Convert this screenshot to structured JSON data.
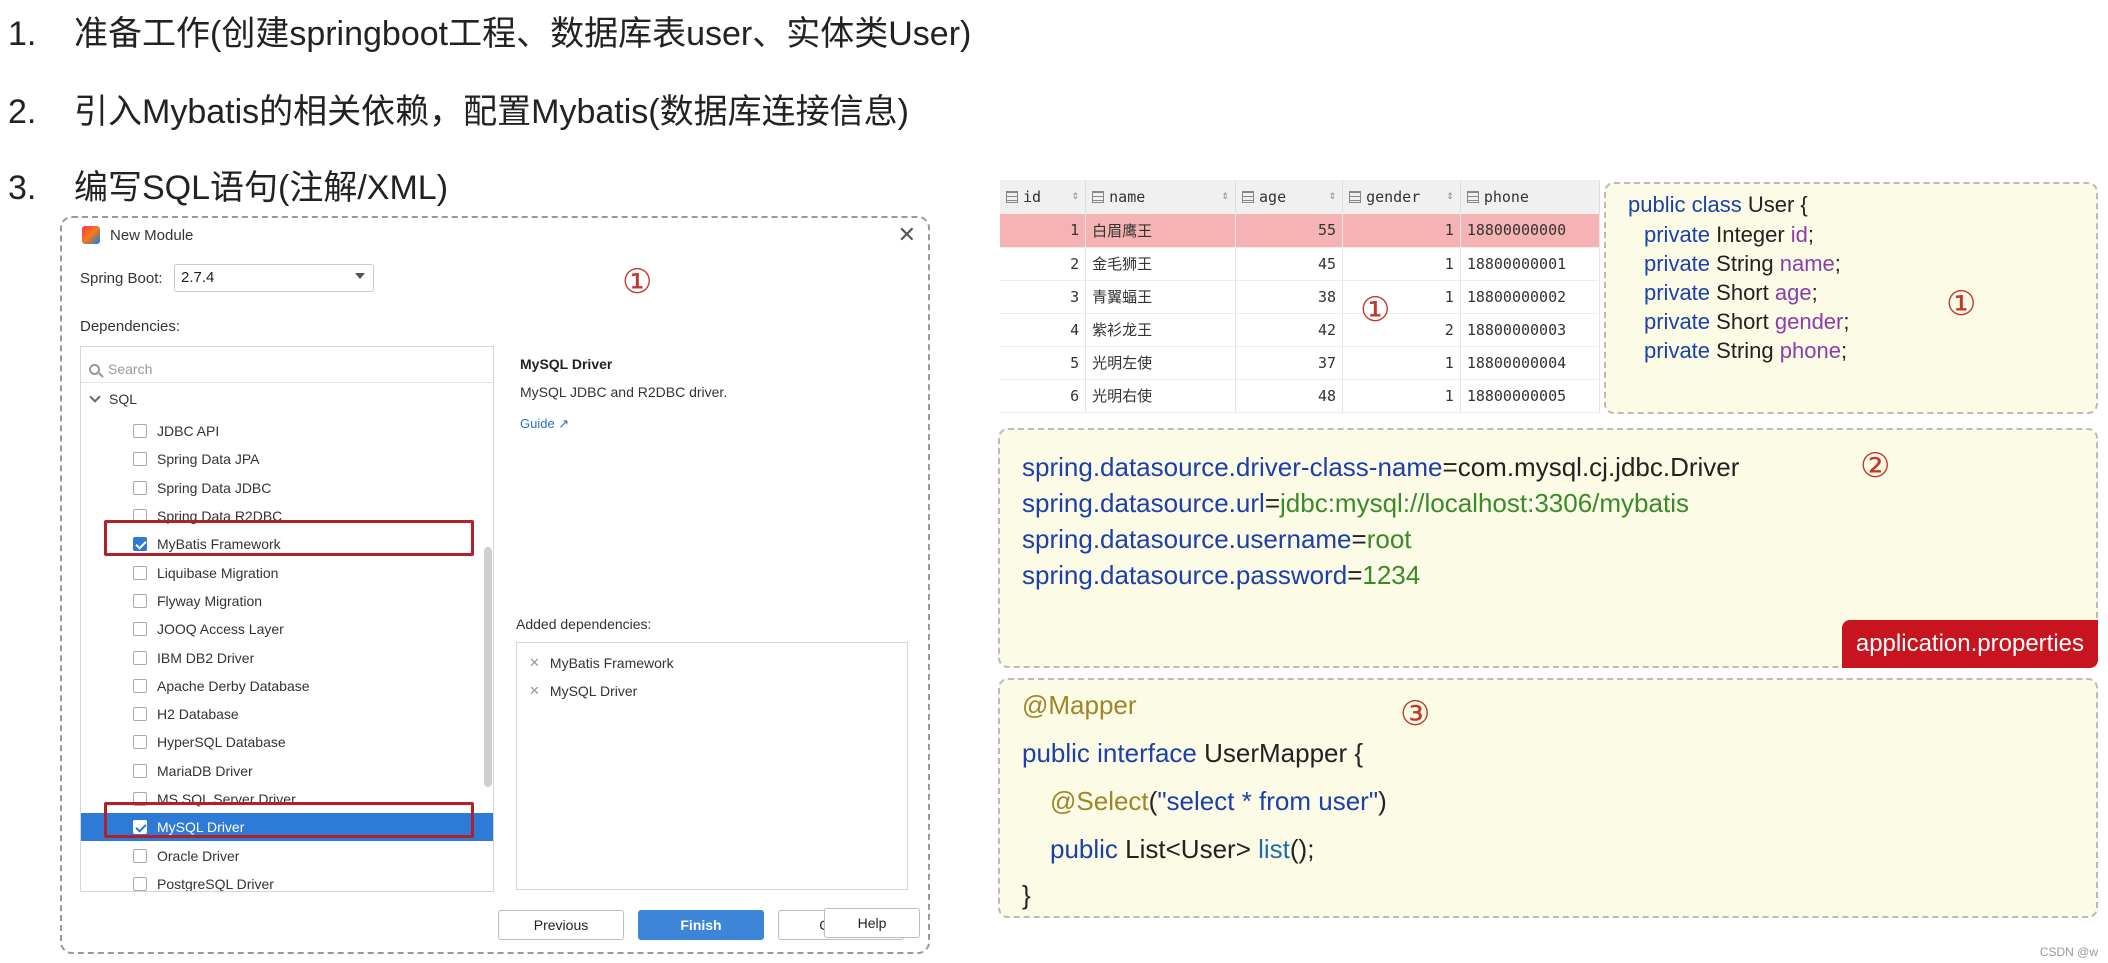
{
  "steps": [
    {
      "num": "1.",
      "text": "准备工作(创建springboot工程、数据库表user、实体类User)"
    },
    {
      "num": "2.",
      "text": "引入Mybatis的相关依赖，配置Mybatis(数据库连接信息)"
    },
    {
      "num": "3.",
      "text": "编写SQL语句(注解/XML)"
    }
  ],
  "dialog": {
    "title": "New Module",
    "spring_boot_label": "Spring Boot:",
    "spring_boot_value": "2.7.4",
    "dependencies_label": "Dependencies:",
    "search_placeholder": "Search",
    "group_name": "SQL",
    "items": [
      {
        "label": "JDBC API",
        "checked": false
      },
      {
        "label": "Spring Data JPA",
        "checked": false
      },
      {
        "label": "Spring Data JDBC",
        "checked": false
      },
      {
        "label": "Spring Data R2DBC",
        "checked": false
      },
      {
        "label": "MyBatis Framework",
        "checked": true
      },
      {
        "label": "Liquibase Migration",
        "checked": false
      },
      {
        "label": "Flyway Migration",
        "checked": false
      },
      {
        "label": "JOOQ Access Layer",
        "checked": false
      },
      {
        "label": "IBM DB2 Driver",
        "checked": false
      },
      {
        "label": "Apache Derby Database",
        "checked": false
      },
      {
        "label": "H2 Database",
        "checked": false
      },
      {
        "label": "HyperSQL Database",
        "checked": false
      },
      {
        "label": "MariaDB Driver",
        "checked": false
      },
      {
        "label": "MS SQL Server Driver",
        "checked": false
      },
      {
        "label": "MySQL Driver",
        "checked": true
      },
      {
        "label": "Oracle Driver",
        "checked": false
      },
      {
        "label": "PostgreSQL Driver",
        "checked": false
      }
    ],
    "detail_title": "MySQL Driver",
    "detail_desc": "MySQL JDBC and R2DBC driver.",
    "detail_guide": "Guide ↗",
    "added_label": "Added dependencies:",
    "added": [
      "MyBatis Framework",
      "MySQL Driver"
    ],
    "buttons": {
      "previous": "Previous",
      "finish": "Finish",
      "cancel": "Cancel",
      "help": "Help"
    },
    "marker": "①"
  },
  "table": {
    "columns": [
      "id",
      "name",
      "age",
      "gender",
      "phone"
    ],
    "rows": [
      [
        "1",
        "白眉鹰王",
        "55",
        "1",
        "18800000000"
      ],
      [
        "2",
        "金毛狮王",
        "45",
        "1",
        "18800000001"
      ],
      [
        "3",
        "青翼蝠王",
        "38",
        "1",
        "18800000002"
      ],
      [
        "4",
        "紫衫龙王",
        "42",
        "2",
        "18800000003"
      ],
      [
        "5",
        "光明左使",
        "37",
        "1",
        "18800000004"
      ],
      [
        "6",
        "光明右使",
        "48",
        "1",
        "18800000005"
      ]
    ],
    "marker": "①"
  },
  "entity": {
    "l1_kw": "public class",
    "l1_rest": " User {",
    "fields": [
      {
        "kw": "private",
        "type": " Integer ",
        "name": "id",
        "end": ";"
      },
      {
        "kw": "private",
        "type": " String ",
        "name": "name",
        "end": ";"
      },
      {
        "kw": "private",
        "type": " Short ",
        "name": "age",
        "end": ";"
      },
      {
        "kw": "private",
        "type": " Short ",
        "name": "gender",
        "end": ";"
      },
      {
        "kw": "private",
        "type": " String ",
        "name": "phone",
        "end": ";"
      }
    ],
    "marker": "①"
  },
  "props": {
    "lines": [
      {
        "key": "spring.datasource.driver-class-name",
        "eq": "=",
        "val": "com.mysql.cj.jdbc.Driver"
      },
      {
        "key": "spring.datasource.url",
        "eq": "=",
        "val": "jdbc:mysql://localhost:3306/mybatis"
      },
      {
        "key": "spring.datasource.username",
        "eq": "=",
        "val": "root"
      },
      {
        "key": "spring.datasource.password",
        "eq": "=",
        "val": "1234"
      }
    ],
    "tag": "application.properties",
    "marker": "②"
  },
  "mapper": {
    "annotation": "@Mapper",
    "l2_kw": "public interface",
    "l2_rest": " UserMapper {",
    "l3_ann": "@Select",
    "l3_open": "(",
    "l3_str": "\"select * from user\"",
    "l3_close": ")",
    "l4_kw": "public",
    "l4_type": " List<User> ",
    "l4_fn": "list",
    "l4_end": "();",
    "l5": "}",
    "marker": "③"
  },
  "watermark": "CSDN @w"
}
